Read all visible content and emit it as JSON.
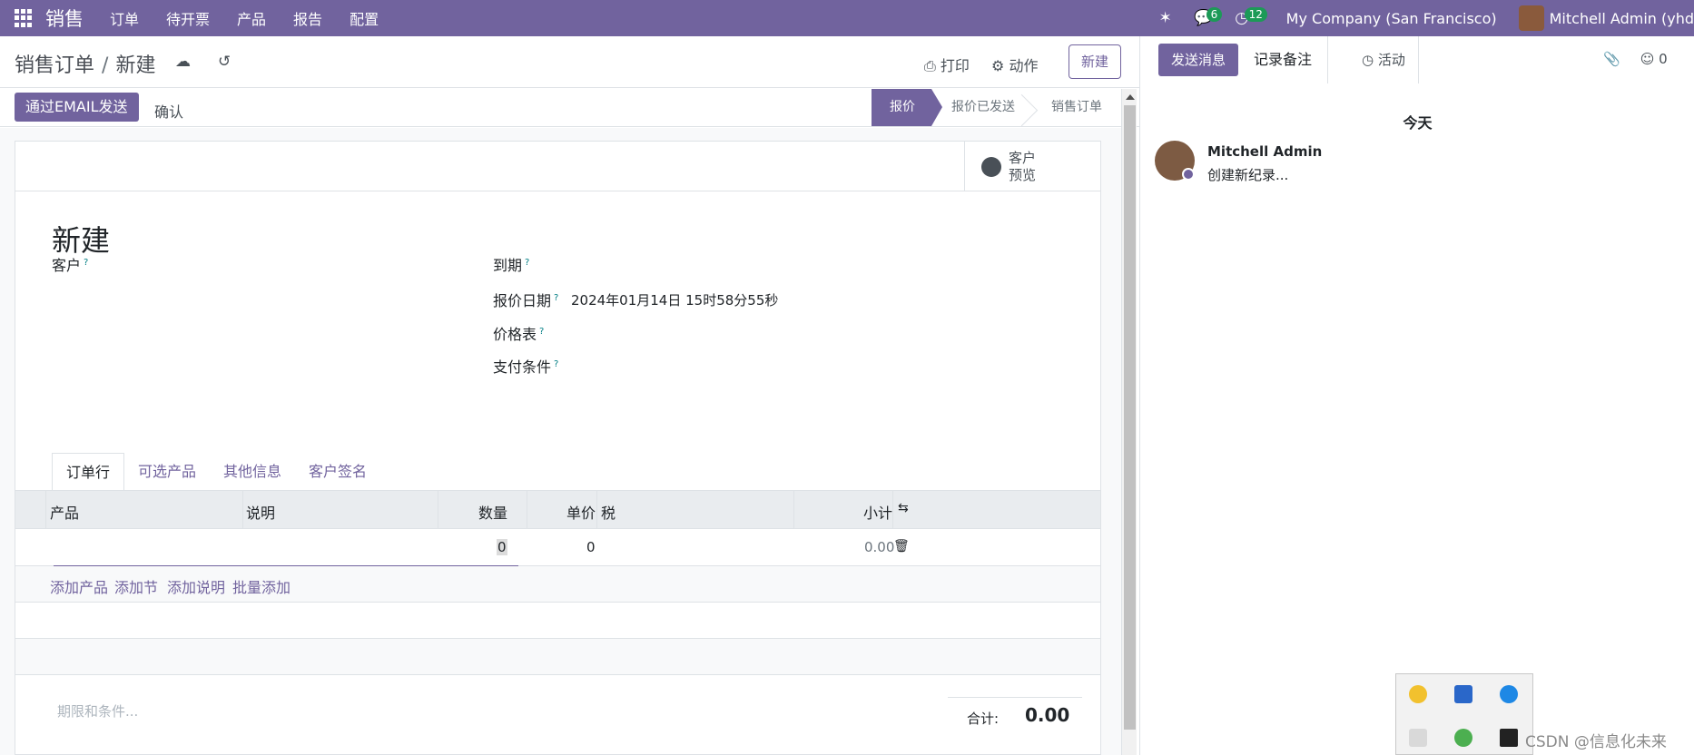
{
  "topnav": {
    "app": "销售",
    "menu": [
      "订单",
      "待开票",
      "产品",
      "报告",
      "配置"
    ],
    "chat_count": "6",
    "activity_count": "12",
    "company": "My Company (San Francisco)",
    "user": "Mitchell Admin (yhd"
  },
  "cpanel": {
    "breadcrumb_parent": "销售订单",
    "breadcrumb_sep": "/",
    "breadcrumb_current": "新建",
    "print": "打印",
    "action": "动作",
    "new": "新建"
  },
  "statusbar": {
    "email": "通过EMAIL发送",
    "confirm": "确认",
    "stages": [
      "报价",
      "报价已发送",
      "销售订单"
    ],
    "active_stage": "报价"
  },
  "form": {
    "preview_line1": "客户",
    "preview_line2": "预览",
    "title": "新建",
    "customer_label": "客户",
    "due_label": "到期",
    "quote_date_label": "报价日期",
    "quote_date_value": "2024年01月14日 15时58分55秒",
    "pricelist_label": "价格表",
    "payment_label": "支付条件",
    "help_mark": "?",
    "tabs": [
      "订单行",
      "可选产品",
      "其他信息",
      "客户签名"
    ],
    "table_headers": {
      "product": "产品",
      "description": "说明",
      "qty": "数量",
      "price": "单价",
      "tax": "税",
      "subtotal": "小计"
    },
    "row": {
      "qty": "0",
      "price": "0",
      "subtotal": "0.00"
    },
    "add_links": [
      "添加产品",
      "添加节",
      "添加说明",
      "批量添加"
    ],
    "terms_placeholder": "期限和条件...",
    "total_label": "合计:",
    "total_value": "0.00"
  },
  "chatter": {
    "send": "发送消息",
    "note": "记录备注",
    "activity": "活动",
    "followers": "0",
    "today": "今天",
    "author": "Mitchell Admin",
    "body": "创建新纪录..."
  },
  "overlay": {
    "watermark": "CSDN @信息化未来"
  },
  "colors": {
    "brand": "#71639e",
    "badge": "#1c9a57"
  }
}
